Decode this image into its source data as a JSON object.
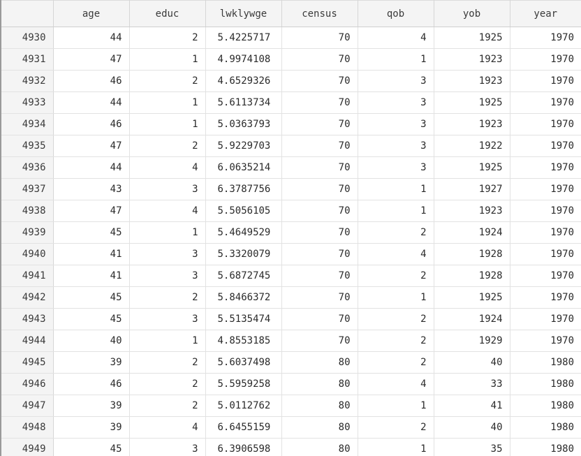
{
  "columns": [
    {
      "key": "obs",
      "label": ""
    },
    {
      "key": "age",
      "label": "age"
    },
    {
      "key": "educ",
      "label": "educ"
    },
    {
      "key": "lwklywge",
      "label": "lwklywge"
    },
    {
      "key": "census",
      "label": "census"
    },
    {
      "key": "qob",
      "label": "qob"
    },
    {
      "key": "yob",
      "label": "yob"
    },
    {
      "key": "year",
      "label": "year"
    }
  ],
  "rows": [
    [
      "4930",
      "44",
      "2",
      "5.4225717",
      "70",
      "4",
      "1925",
      "1970"
    ],
    [
      "4931",
      "47",
      "1",
      "4.9974108",
      "70",
      "1",
      "1923",
      "1970"
    ],
    [
      "4932",
      "46",
      "2",
      "4.6529326",
      "70",
      "3",
      "1923",
      "1970"
    ],
    [
      "4933",
      "44",
      "1",
      "5.6113734",
      "70",
      "3",
      "1925",
      "1970"
    ],
    [
      "4934",
      "46",
      "1",
      "5.0363793",
      "70",
      "3",
      "1923",
      "1970"
    ],
    [
      "4935",
      "47",
      "2",
      "5.9229703",
      "70",
      "3",
      "1922",
      "1970"
    ],
    [
      "4936",
      "44",
      "4",
      "6.0635214",
      "70",
      "3",
      "1925",
      "1970"
    ],
    [
      "4937",
      "43",
      "3",
      "6.3787756",
      "70",
      "1",
      "1927",
      "1970"
    ],
    [
      "4938",
      "47",
      "4",
      "5.5056105",
      "70",
      "1",
      "1923",
      "1970"
    ],
    [
      "4939",
      "45",
      "1",
      "5.4649529",
      "70",
      "2",
      "1924",
      "1970"
    ],
    [
      "4940",
      "41",
      "3",
      "5.3320079",
      "70",
      "4",
      "1928",
      "1970"
    ],
    [
      "4941",
      "41",
      "3",
      "5.6872745",
      "70",
      "2",
      "1928",
      "1970"
    ],
    [
      "4942",
      "45",
      "2",
      "5.8466372",
      "70",
      "1",
      "1925",
      "1970"
    ],
    [
      "4943",
      "45",
      "3",
      "5.5135474",
      "70",
      "2",
      "1924",
      "1970"
    ],
    [
      "4944",
      "40",
      "1",
      "4.8553185",
      "70",
      "2",
      "1929",
      "1970"
    ],
    [
      "4945",
      "39",
      "2",
      "5.6037498",
      "80",
      "2",
      "40",
      "1980"
    ],
    [
      "4946",
      "46",
      "2",
      "5.5959258",
      "80",
      "4",
      "33",
      "1980"
    ],
    [
      "4947",
      "39",
      "2",
      "5.0112762",
      "80",
      "1",
      "41",
      "1980"
    ],
    [
      "4948",
      "39",
      "4",
      "6.6455159",
      "80",
      "2",
      "40",
      "1980"
    ],
    [
      "4949",
      "45",
      "3",
      "6.3906598",
      "80",
      "1",
      "35",
      "1980"
    ]
  ]
}
